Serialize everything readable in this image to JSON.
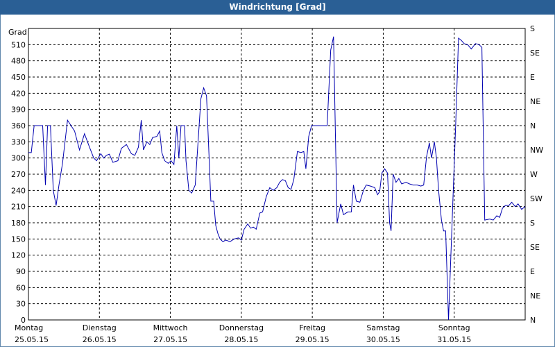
{
  "window": {
    "title": "Windrichtung [Grad]"
  },
  "chart_data": {
    "type": "line",
    "title": "Windrichtung [Grad]",
    "ylabel": "Grad",
    "ylim": [
      0,
      540
    ],
    "yticks": [
      0,
      30,
      60,
      90,
      120,
      150,
      180,
      210,
      240,
      270,
      300,
      330,
      360,
      390,
      420,
      450,
      480,
      510
    ],
    "y2ticks": [
      {
        "value": 0,
        "label": "N"
      },
      {
        "value": 45,
        "label": "NE"
      },
      {
        "value": 90,
        "label": "E"
      },
      {
        "value": 135,
        "label": "SE"
      },
      {
        "value": 180,
        "label": "S"
      },
      {
        "value": 225,
        "label": "SW"
      },
      {
        "value": 270,
        "label": "W"
      },
      {
        "value": 315,
        "label": "NW"
      },
      {
        "value": 360,
        "label": "N"
      },
      {
        "value": 405,
        "label": "NE"
      },
      {
        "value": 450,
        "label": "E"
      },
      {
        "value": 495,
        "label": "SE"
      },
      {
        "value": 540,
        "label": "S"
      }
    ],
    "xlim": [
      0,
      7
    ],
    "days": [
      {
        "day": "Montag",
        "date": "25.05.15"
      },
      {
        "day": "Dienstag",
        "date": "26.05.15"
      },
      {
        "day": "Mittwoch",
        "date": "27.05.15"
      },
      {
        "day": "Donnerstag",
        "date": "28.05.15"
      },
      {
        "day": "Freitag",
        "date": "29.05.15"
      },
      {
        "day": "Samstag",
        "date": "30.05.15"
      },
      {
        "day": "Sonntag",
        "date": "31.05.15"
      }
    ],
    "grid": true,
    "color": "#0000b0",
    "series": [
      {
        "name": "",
        "points": [
          [
            0.0,
            310
          ],
          [
            0.04,
            310
          ],
          [
            0.08,
            360
          ],
          [
            0.15,
            360
          ],
          [
            0.2,
            360
          ],
          [
            0.24,
            250
          ],
          [
            0.27,
            360
          ],
          [
            0.31,
            360
          ],
          [
            0.35,
            240
          ],
          [
            0.39,
            212
          ],
          [
            0.43,
            250
          ],
          [
            0.48,
            290
          ],
          [
            0.55,
            370
          ],
          [
            0.6,
            360
          ],
          [
            0.65,
            350
          ],
          [
            0.72,
            315
          ],
          [
            0.79,
            345
          ],
          [
            0.86,
            320
          ],
          [
            0.92,
            300
          ],
          [
            0.96,
            295
          ],
          [
            1.02,
            308
          ],
          [
            1.06,
            300
          ],
          [
            1.1,
            305
          ],
          [
            1.14,
            307
          ],
          [
            1.19,
            292
          ],
          [
            1.26,
            295
          ],
          [
            1.31,
            318
          ],
          [
            1.38,
            325
          ],
          [
            1.45,
            308
          ],
          [
            1.5,
            305
          ],
          [
            1.55,
            320
          ],
          [
            1.59,
            370
          ],
          [
            1.62,
            315
          ],
          [
            1.67,
            330
          ],
          [
            1.71,
            325
          ],
          [
            1.75,
            338
          ],
          [
            1.81,
            340
          ],
          [
            1.85,
            350
          ],
          [
            1.88,
            310
          ],
          [
            1.92,
            295
          ],
          [
            1.97,
            290
          ],
          [
            2.01,
            295
          ],
          [
            2.05,
            288
          ],
          [
            2.09,
            360
          ],
          [
            2.12,
            300
          ],
          [
            2.15,
            360
          ],
          [
            2.2,
            360
          ],
          [
            2.22,
            295
          ],
          [
            2.26,
            240
          ],
          [
            2.3,
            235
          ],
          [
            2.35,
            250
          ],
          [
            2.39,
            330
          ],
          [
            2.43,
            410
          ],
          [
            2.47,
            430
          ],
          [
            2.51,
            415
          ],
          [
            2.54,
            320
          ],
          [
            2.57,
            220
          ],
          [
            2.61,
            220
          ],
          [
            2.64,
            175
          ],
          [
            2.67,
            160
          ],
          [
            2.7,
            150
          ],
          [
            2.74,
            145
          ],
          [
            2.78,
            148
          ],
          [
            2.84,
            145
          ],
          [
            2.9,
            150
          ],
          [
            2.96,
            152
          ],
          [
            3.0,
            148
          ],
          [
            3.04,
            168
          ],
          [
            3.09,
            178
          ],
          [
            3.13,
            170
          ],
          [
            3.17,
            172
          ],
          [
            3.21,
            168
          ],
          [
            3.26,
            198
          ],
          [
            3.3,
            200
          ],
          [
            3.35,
            228
          ],
          [
            3.4,
            245
          ],
          [
            3.45,
            240
          ],
          [
            3.5,
            245
          ],
          [
            3.54,
            255
          ],
          [
            3.58,
            260
          ],
          [
            3.62,
            258
          ],
          [
            3.66,
            245
          ],
          [
            3.7,
            242
          ],
          [
            3.74,
            260
          ],
          [
            3.79,
            312
          ],
          [
            3.84,
            310
          ],
          [
            3.88,
            312
          ],
          [
            3.91,
            280
          ],
          [
            3.95,
            340
          ],
          [
            3.99,
            360
          ],
          [
            4.1,
            360
          ],
          [
            4.21,
            360
          ],
          [
            4.26,
            500
          ],
          [
            4.3,
            525
          ],
          [
            4.35,
            180
          ],
          [
            4.4,
            215
          ],
          [
            4.44,
            195
          ],
          [
            4.5,
            200
          ],
          [
            4.55,
            200
          ],
          [
            4.58,
            250
          ],
          [
            4.62,
            220
          ],
          [
            4.67,
            218
          ],
          [
            4.72,
            240
          ],
          [
            4.76,
            250
          ],
          [
            4.82,
            248
          ],
          [
            4.88,
            245
          ],
          [
            4.92,
            232
          ],
          [
            4.95,
            238
          ],
          [
            4.98,
            272
          ],
          [
            5.02,
            280
          ],
          [
            5.06,
            272
          ],
          [
            5.09,
            180
          ],
          [
            5.11,
            165
          ],
          [
            5.14,
            270
          ],
          [
            5.18,
            255
          ],
          [
            5.22,
            262
          ],
          [
            5.26,
            252
          ],
          [
            5.32,
            255
          ],
          [
            5.37,
            252
          ],
          [
            5.42,
            250
          ],
          [
            5.48,
            250
          ],
          [
            5.53,
            248
          ],
          [
            5.57,
            250
          ],
          [
            5.61,
            302
          ],
          [
            5.65,
            328
          ],
          [
            5.68,
            300
          ],
          [
            5.72,
            330
          ],
          [
            5.75,
            300
          ],
          [
            5.78,
            240
          ],
          [
            5.82,
            185
          ],
          [
            5.85,
            165
          ],
          [
            5.88,
            165
          ],
          [
            5.92,
            0
          ],
          [
            6.02,
            360
          ],
          [
            6.06,
            522
          ],
          [
            6.1,
            518
          ],
          [
            6.14,
            512
          ],
          [
            6.19,
            510
          ],
          [
            6.24,
            502
          ],
          [
            6.3,
            512
          ],
          [
            6.35,
            510
          ],
          [
            6.39,
            505
          ],
          [
            6.43,
            185
          ],
          [
            6.5,
            187
          ],
          [
            6.55,
            185
          ],
          [
            6.6,
            193
          ],
          [
            6.64,
            190
          ],
          [
            6.68,
            207
          ],
          [
            6.72,
            212
          ],
          [
            6.77,
            212
          ],
          [
            6.81,
            218
          ],
          [
            6.86,
            210
          ],
          [
            6.9,
            215
          ],
          [
            6.95,
            205
          ],
          [
            7.0,
            210
          ]
        ]
      }
    ]
  }
}
